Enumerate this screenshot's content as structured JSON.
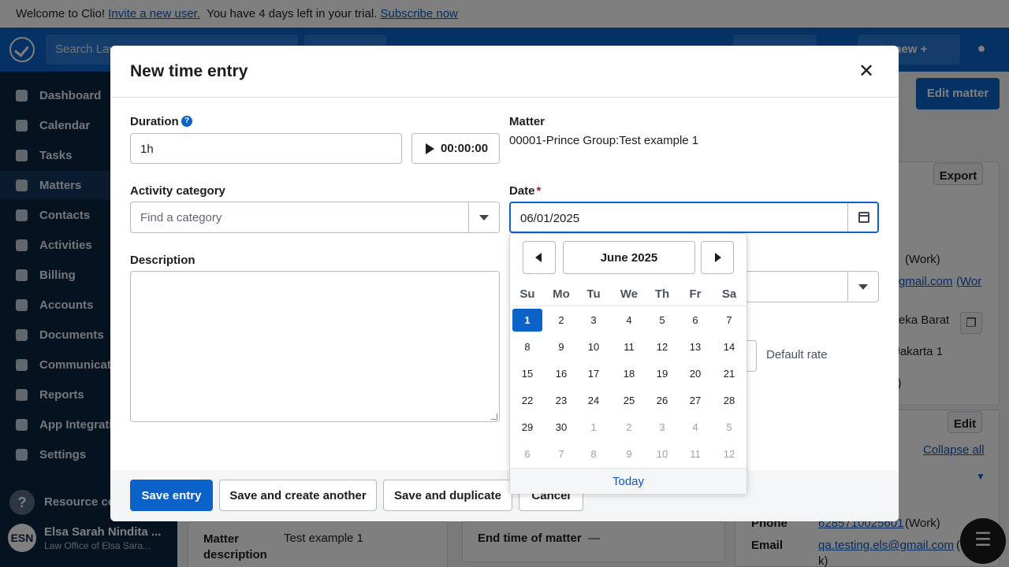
{
  "banner": {
    "welcome": "Welcome to Clio!",
    "invite_link": "Invite a new user.",
    "trial_text": "You have 4 days left in your trial.",
    "subscribe_link": "Subscribe now"
  },
  "topbar": {
    "search_placeholder": "Search Law",
    "create_new": "eate new",
    "create_plus": "+"
  },
  "sidebar": {
    "items": [
      {
        "label": "Dashboard",
        "icon": "home-icon"
      },
      {
        "label": "Calendar",
        "icon": "calendar-icon"
      },
      {
        "label": "Tasks",
        "icon": "tasks-icon"
      },
      {
        "label": "Matters",
        "icon": "briefcase-icon"
      },
      {
        "label": "Contacts",
        "icon": "contacts-icon"
      },
      {
        "label": "Activities",
        "icon": "clock-icon"
      },
      {
        "label": "Billing",
        "icon": "billing-icon"
      },
      {
        "label": "Accounts",
        "icon": "bank-icon"
      },
      {
        "label": "Documents",
        "icon": "folder-icon"
      },
      {
        "label": "Communications",
        "icon": "chat-icon"
      },
      {
        "label": "Reports",
        "icon": "chart-icon"
      },
      {
        "label": "App Integrations",
        "icon": "apps-icon"
      },
      {
        "label": "Settings",
        "icon": "gear-icon"
      }
    ],
    "active_index": 3,
    "help_label": "Resource center",
    "user_initials": "ESN",
    "user_name": "Elsa Sarah Nindita ...",
    "user_firm": "Law Office of Elsa Sara..."
  },
  "background": {
    "edit_matter": "Edit matter",
    "export": "Export",
    "work1": "(Work)",
    "gmail_partial": "gmail.com",
    "wor": "(Wor",
    "address1": "eka Barat",
    "address2": ", Jakarta 1",
    "rk": "rk)",
    "edit": "Edit",
    "collapse_all": "Collapse all",
    "matter_description_label": "Matter description",
    "matter_description_value": "Test example 1",
    "end_time_label": "End time of matter",
    "end_time_value": "—",
    "phone_label": "Phone",
    "phone_value": "6285710025601",
    "phone_type": "(Work)",
    "email_label": "Email",
    "email_value": "qa.testing.els@gmail.com",
    "email_type": "(",
    "email_type2": "k)"
  },
  "modal": {
    "title": "New time entry",
    "duration_label": "Duration",
    "duration_value": "1h",
    "timer_label": "00:00:00",
    "matter_label": "Matter",
    "matter_value": "00001-Prince Group:Test example 1",
    "activity_label": "Activity category",
    "activity_placeholder": "Find a category",
    "date_label": "Date",
    "date_required": "*",
    "date_value": "06/01/2025",
    "description_label": "Description",
    "default_rate": "Default rate",
    "buttons": {
      "save_entry": "Save entry",
      "save_create_another": "Save and create another",
      "save_duplicate": "Save and duplicate",
      "cancel": "Cancel"
    }
  },
  "datepicker": {
    "month_label": "June 2025",
    "weekdays": [
      "Su",
      "Mo",
      "Tu",
      "We",
      "Th",
      "Fr",
      "Sa"
    ],
    "weeks": [
      [
        {
          "d": "1",
          "o": false,
          "s": true
        },
        {
          "d": "2",
          "o": false
        },
        {
          "d": "3",
          "o": false
        },
        {
          "d": "4",
          "o": false
        },
        {
          "d": "5",
          "o": false
        },
        {
          "d": "6",
          "o": false
        },
        {
          "d": "7",
          "o": false
        }
      ],
      [
        {
          "d": "8",
          "o": false
        },
        {
          "d": "9",
          "o": false
        },
        {
          "d": "10",
          "o": false
        },
        {
          "d": "11",
          "o": false
        },
        {
          "d": "12",
          "o": false
        },
        {
          "d": "13",
          "o": false
        },
        {
          "d": "14",
          "o": false
        }
      ],
      [
        {
          "d": "15",
          "o": false
        },
        {
          "d": "16",
          "o": false
        },
        {
          "d": "17",
          "o": false
        },
        {
          "d": "18",
          "o": false
        },
        {
          "d": "19",
          "o": false
        },
        {
          "d": "20",
          "o": false
        },
        {
          "d": "21",
          "o": false
        }
      ],
      [
        {
          "d": "22",
          "o": false
        },
        {
          "d": "23",
          "o": false
        },
        {
          "d": "24",
          "o": false
        },
        {
          "d": "25",
          "o": false
        },
        {
          "d": "26",
          "o": false
        },
        {
          "d": "27",
          "o": false
        },
        {
          "d": "28",
          "o": false
        }
      ],
      [
        {
          "d": "29",
          "o": false
        },
        {
          "d": "30",
          "o": false
        },
        {
          "d": "1",
          "o": true
        },
        {
          "d": "2",
          "o": true
        },
        {
          "d": "3",
          "o": true
        },
        {
          "d": "4",
          "o": true
        },
        {
          "d": "5",
          "o": true
        }
      ],
      [
        {
          "d": "6",
          "o": true
        },
        {
          "d": "7",
          "o": true
        },
        {
          "d": "8",
          "o": true
        },
        {
          "d": "9",
          "o": true
        },
        {
          "d": "10",
          "o": true
        },
        {
          "d": "11",
          "o": true
        },
        {
          "d": "12",
          "o": true
        }
      ]
    ],
    "today_label": "Today"
  },
  "colors": {
    "primary": "#0b62c9",
    "sidebar": "#0a2540",
    "link": "#0c58bd",
    "required": "#c8102e"
  }
}
